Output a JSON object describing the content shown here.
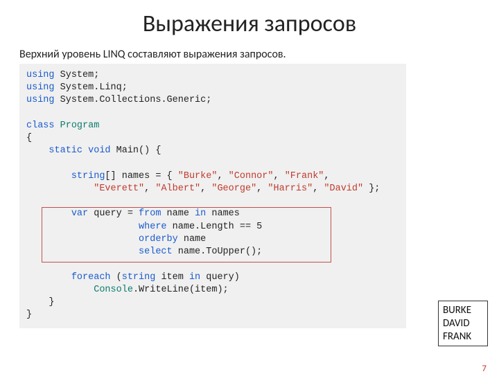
{
  "title": "Выражения запросов",
  "subtitle": "Верхний уровень LINQ составляют выражения запросов.",
  "code": {
    "l1a": "using",
    "l1b": " System;",
    "l2a": "using",
    "l2b": " System.Linq;",
    "l3a": "using",
    "l3b": " System.Collections.Generic;",
    "l5a": "class",
    "l5b": " ",
    "l5c": "Program",
    "l6": "{",
    "l7a": "    ",
    "l7b": "static",
    "l7c": " ",
    "l7d": "void",
    "l7e": " Main() {",
    "l9a": "        ",
    "l9b": "string",
    "l9c": "[] names = { ",
    "l9d": "\"Burke\"",
    "l9e": ", ",
    "l9f": "\"Connor\"",
    "l9g": ", ",
    "l9h": "\"Frank\"",
    "l9i": ",",
    "l10a": "            ",
    "l10b": "\"Everett\"",
    "l10c": ", ",
    "l10d": "\"Albert\"",
    "l10e": ", ",
    "l10f": "\"George\"",
    "l10g": ", ",
    "l10h": "\"Harris\"",
    "l10i": ", ",
    "l10j": "\"David\"",
    "l10k": " };",
    "l12a": "        ",
    "l12b": "var",
    "l12c": " query = ",
    "l12d": "from",
    "l12e": " name ",
    "l12f": "in",
    "l12g": " names",
    "l13a": "                    ",
    "l13b": "where",
    "l13c": " name.Length == 5",
    "l14a": "                    ",
    "l14b": "orderby",
    "l14c": " name",
    "l15a": "                    ",
    "l15b": "select",
    "l15c": " name.ToUpper();",
    "l17a": "        ",
    "l17b": "foreach",
    "l17c": " (",
    "l17d": "string",
    "l17e": " item ",
    "l17f": "in",
    "l17g": " query)",
    "l18a": "            ",
    "l18b": "Console",
    "l18c": ".WriteLine(item);",
    "l19": "    }",
    "l20": "}"
  },
  "output": {
    "line1": "BURKE",
    "line2": "DAVID",
    "line3": "FRANK"
  },
  "page_number": "7"
}
